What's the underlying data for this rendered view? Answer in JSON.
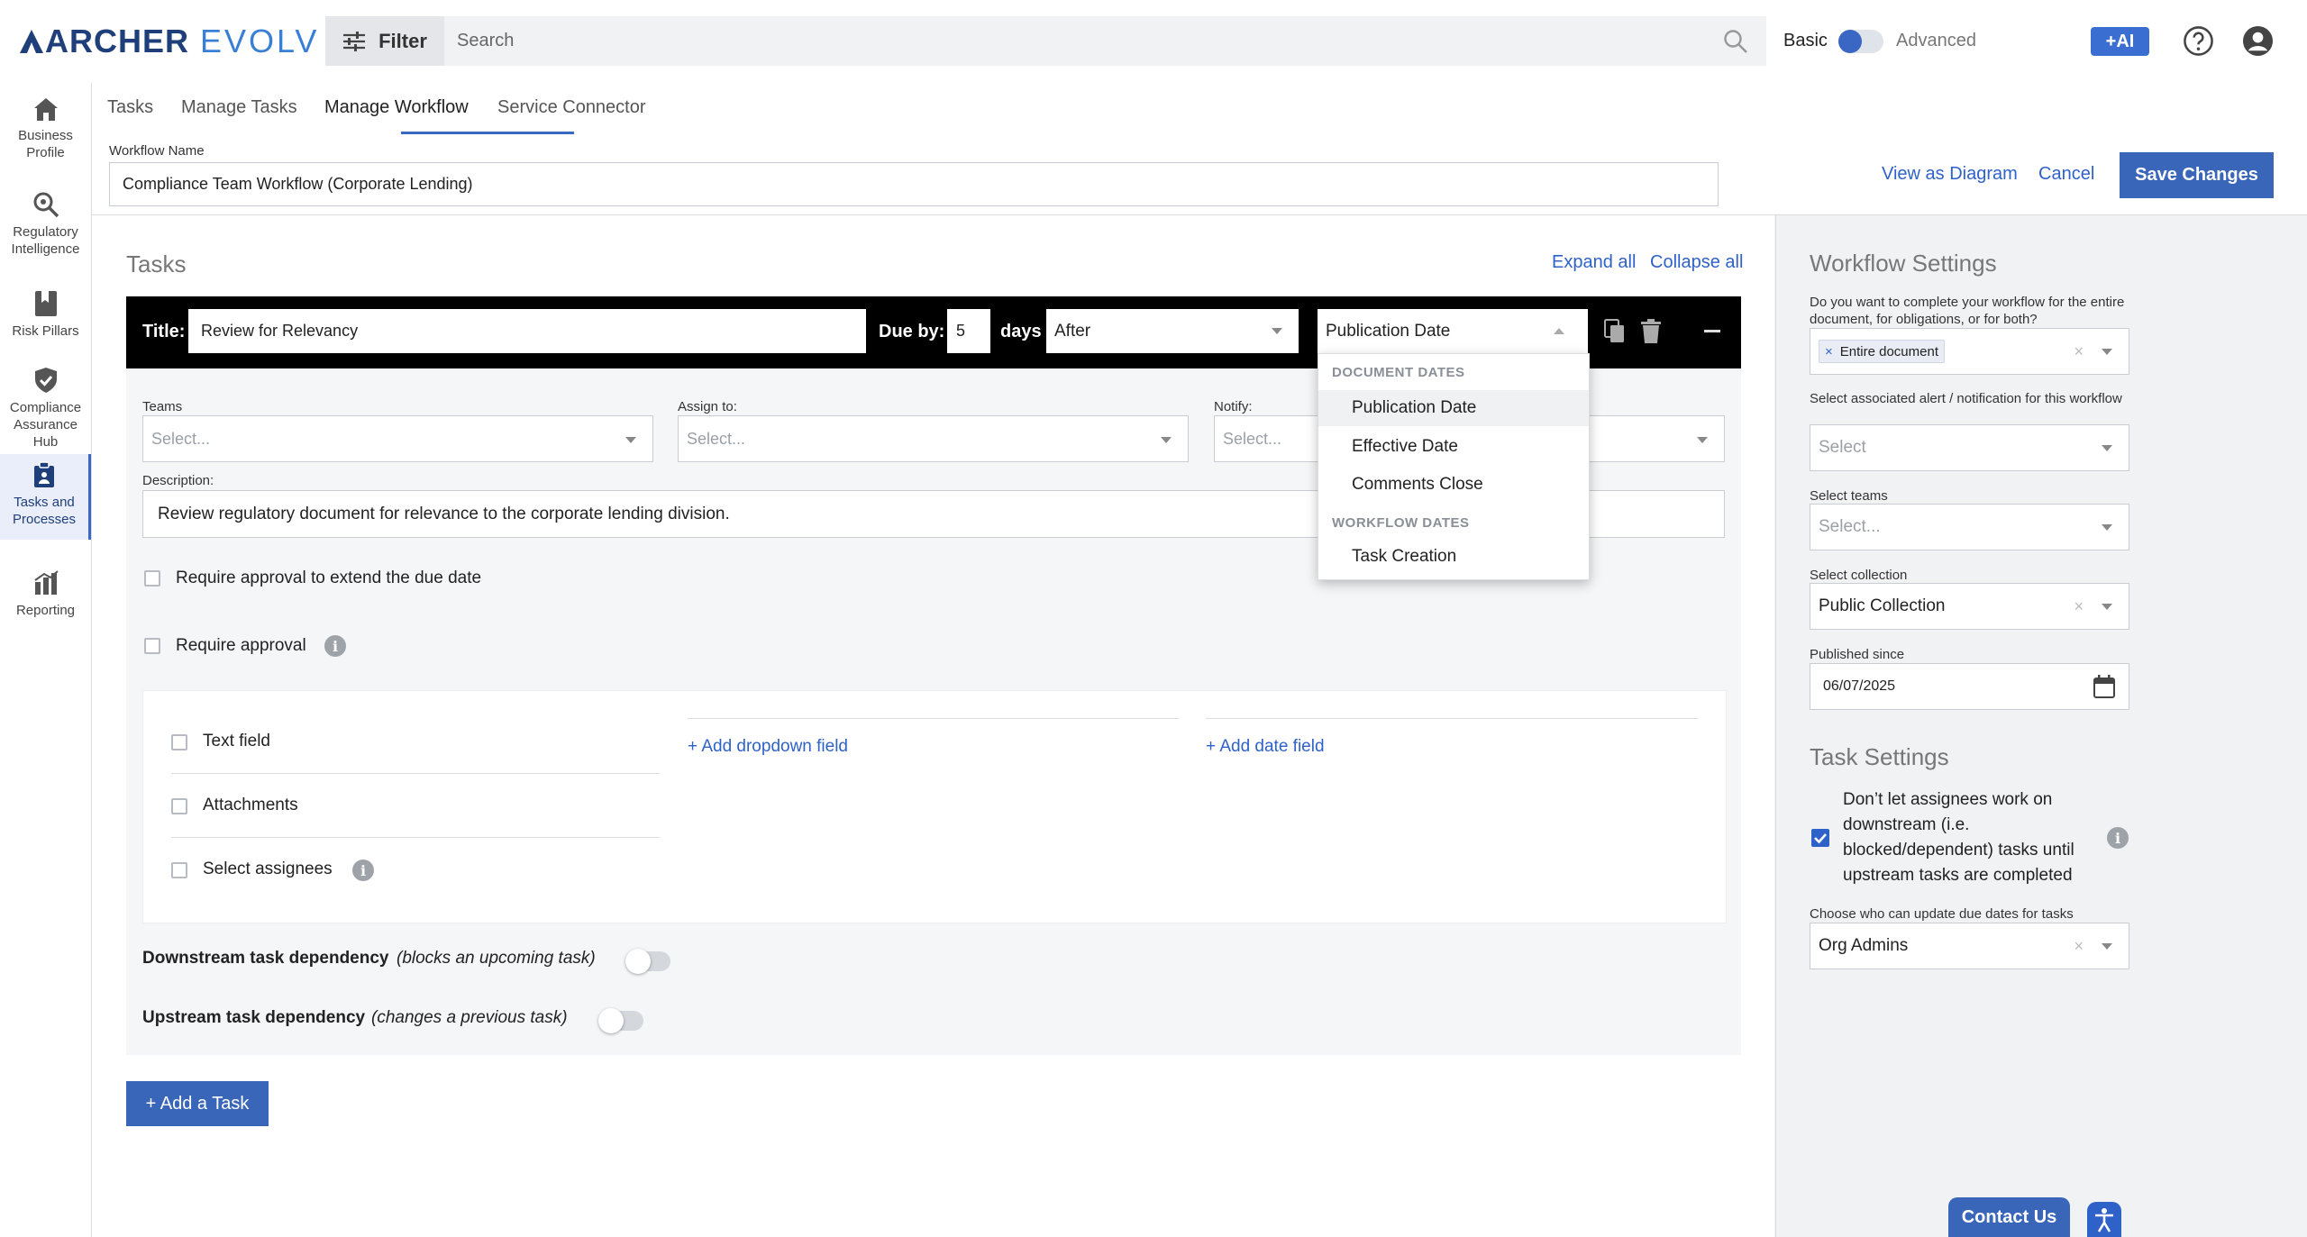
{
  "brand": {
    "part1": "ARCHER",
    "part2": "EVOLV"
  },
  "header": {
    "filter_label": "Filter",
    "search_placeholder": "Search",
    "mode_basic": "Basic",
    "mode_advanced": "Advanced",
    "ai_label": "+AI"
  },
  "nav": [
    {
      "label1": "Business",
      "label2": "Profile",
      "icon": "home-icon"
    },
    {
      "label1": "Regulatory",
      "label2": "Intelligence",
      "icon": "magnifier-icon"
    },
    {
      "label1": "Risk Pillars",
      "label2": "",
      "icon": "bookmark-icon"
    },
    {
      "label1": "Compliance",
      "label2": "Assurance",
      "label3": "Hub",
      "icon": "shield-check-icon"
    },
    {
      "label1": "Tasks and",
      "label2": "Processes",
      "icon": "clipboard-icon"
    },
    {
      "label1": "Reporting",
      "label2": "",
      "icon": "bar-chart-icon"
    }
  ],
  "tabs": [
    "Tasks",
    "Manage Tasks",
    "Manage Workflow",
    "Service Connector"
  ],
  "workflow": {
    "name_label": "Workflow Name",
    "name_value": "Compliance Team Workflow (Corporate Lending)",
    "view_diagram": "View as Diagram",
    "cancel": "Cancel",
    "save": "Save Changes"
  },
  "tasks": {
    "heading": "Tasks",
    "expand_all": "Expand all",
    "collapse_all": "Collapse all",
    "add_task": "+ Add a Task"
  },
  "task": {
    "title_label": "Title:",
    "title_value": "Review for Relevancy",
    "due_label": "Due by:",
    "due_value": "5",
    "days_label": "days",
    "relation_value": "After",
    "date_ref_value": "Publication Date",
    "teams_label": "Teams",
    "teams_placeholder": "Select...",
    "assign_label": "Assign to:",
    "assign_placeholder": "Select...",
    "notify_label": "Notify:",
    "notify_placeholder": "Select...",
    "description_label": "Description:",
    "description_value": "Review regulatory document for relevance to the corporate lending division.",
    "require_extend_label": "Require approval to extend the due date",
    "require_approval_label": "Require approval",
    "text_field_label": "Text field",
    "attachments_label": "Attachments",
    "select_assignees_label": "Select assignees",
    "add_dropdown_field": "+ Add dropdown field",
    "add_date_field": "+ Add date field",
    "downstream_label": "Downstream task dependency",
    "downstream_note": "(blocks an upcoming task)",
    "upstream_label": "Upstream task dependency",
    "upstream_note": "(changes a previous task)"
  },
  "date_menu": {
    "group1": "DOCUMENT DATES",
    "items1": [
      "Publication Date",
      "Effective Date",
      "Comments Close"
    ],
    "group2": "WORKFLOW DATES",
    "items2": [
      "Task Creation"
    ]
  },
  "settings": {
    "heading": "Workflow Settings",
    "q1": "Do you want to complete your workflow for the entire document, for obligations, or for both?",
    "q1_chip": "Entire document",
    "alert_label": "Select associated alert / notification for this workflow",
    "alert_placeholder": "Select",
    "teams_label": "Select teams",
    "teams_placeholder": "Select...",
    "collection_label": "Select collection",
    "collection_value": "Public Collection",
    "published_label": "Published since",
    "published_value": "06/07/2025",
    "task_heading": "Task Settings",
    "block_label": "Don’t let assignees work on downstream (i.e. blocked/dependent) tasks until upstream tasks are completed",
    "due_update_label": "Choose who can update due dates for tasks",
    "due_update_value": "Org Admins"
  },
  "footer": {
    "contact": "Contact Us"
  },
  "colors": {
    "accent": "#3a66b9",
    "link": "#2f62c8",
    "brand_dark": "#1f3f7a"
  }
}
